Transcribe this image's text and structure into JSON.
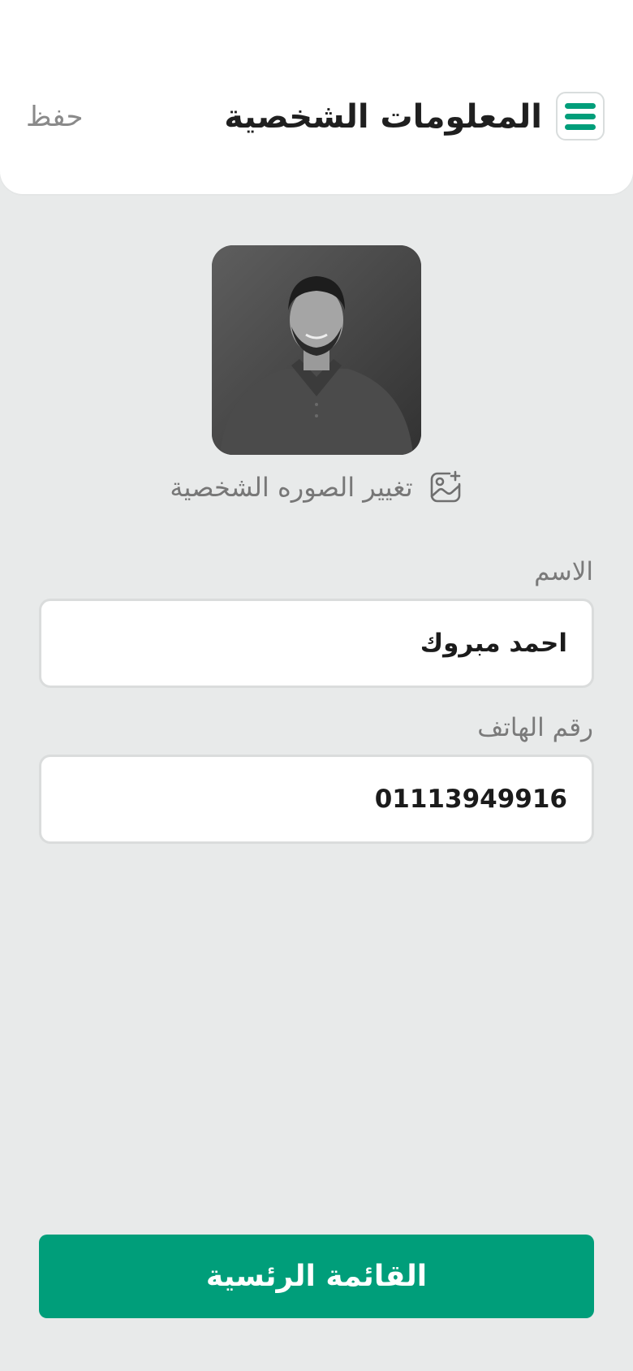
{
  "header": {
    "title": "المعلومات الشخصية",
    "save_label": "حفظ",
    "menu_icon": "hamburger-menu-icon"
  },
  "profile": {
    "avatar_alt": "",
    "change_photo_label": "تغيير الصوره الشخصية",
    "change_photo_icon": "image-plus-icon"
  },
  "form": {
    "name_label": "الاسم",
    "name_value": "احمد مبروك",
    "phone_label": "رقم الهاتف",
    "phone_value": "01113949916"
  },
  "footer": {
    "home_button_label": "القائمة الرئسية"
  },
  "colors": {
    "accent": "#009e7a",
    "background": "#e8eaea",
    "surface": "#ffffff"
  }
}
